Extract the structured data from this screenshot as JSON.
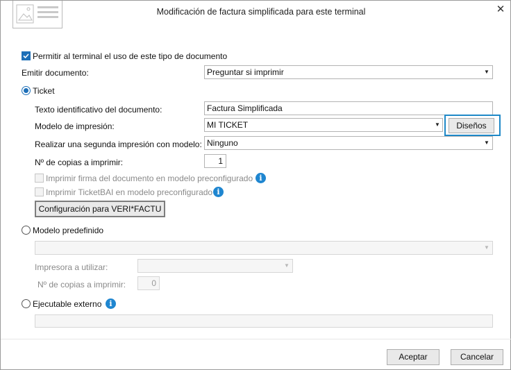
{
  "dialog": {
    "title": "Modificación de factura simplificada para este terminal",
    "close_glyph": "✕"
  },
  "allow": {
    "label": "Permitir al terminal el uso de este tipo de documento",
    "checked": true
  },
  "emitir": {
    "label": "Emitir documento:",
    "value": "Preguntar si imprimir"
  },
  "ticket": {
    "label": "Ticket",
    "selected": true,
    "texto_label": "Texto identificativo del documento:",
    "texto_value": "Factura Simplificada",
    "modelo_label": "Modelo de impresión:",
    "modelo_value": "MI TICKET",
    "disenos_button": "Diseños",
    "segunda_label": "Realizar una segunda impresión con modelo:",
    "segunda_value": "Ninguno",
    "copias_label": "Nº de copias a imprimir:",
    "copias_value": "1",
    "firma_label": "Imprimir firma del documento en modelo preconfigurado",
    "ticketbai_label": "Imprimir TicketBAI en modelo preconfigurado",
    "verifactu_button": "Configuración para VERI*FACTU"
  },
  "modelo_predefinido": {
    "label": "Modelo predefinido",
    "selected": false,
    "value": "",
    "impresora_label": "Impresora a utilizar:",
    "impresora_value": "",
    "copias_label": "Nº de copias a imprimir:",
    "copias_value": "0"
  },
  "ejecutable": {
    "label": "Ejecutable externo",
    "selected": false,
    "path_value": ""
  },
  "footer": {
    "accept_button": "Aceptar",
    "cancel_button": "Cancelar"
  },
  "icons": {
    "info": "info-icon",
    "dropdown": "chevron-down-icon",
    "checkmark": "checkmark-icon"
  },
  "colors": {
    "accent": "#1d6fb8",
    "focus": "#1e88c7",
    "info": "#1f86d0"
  }
}
